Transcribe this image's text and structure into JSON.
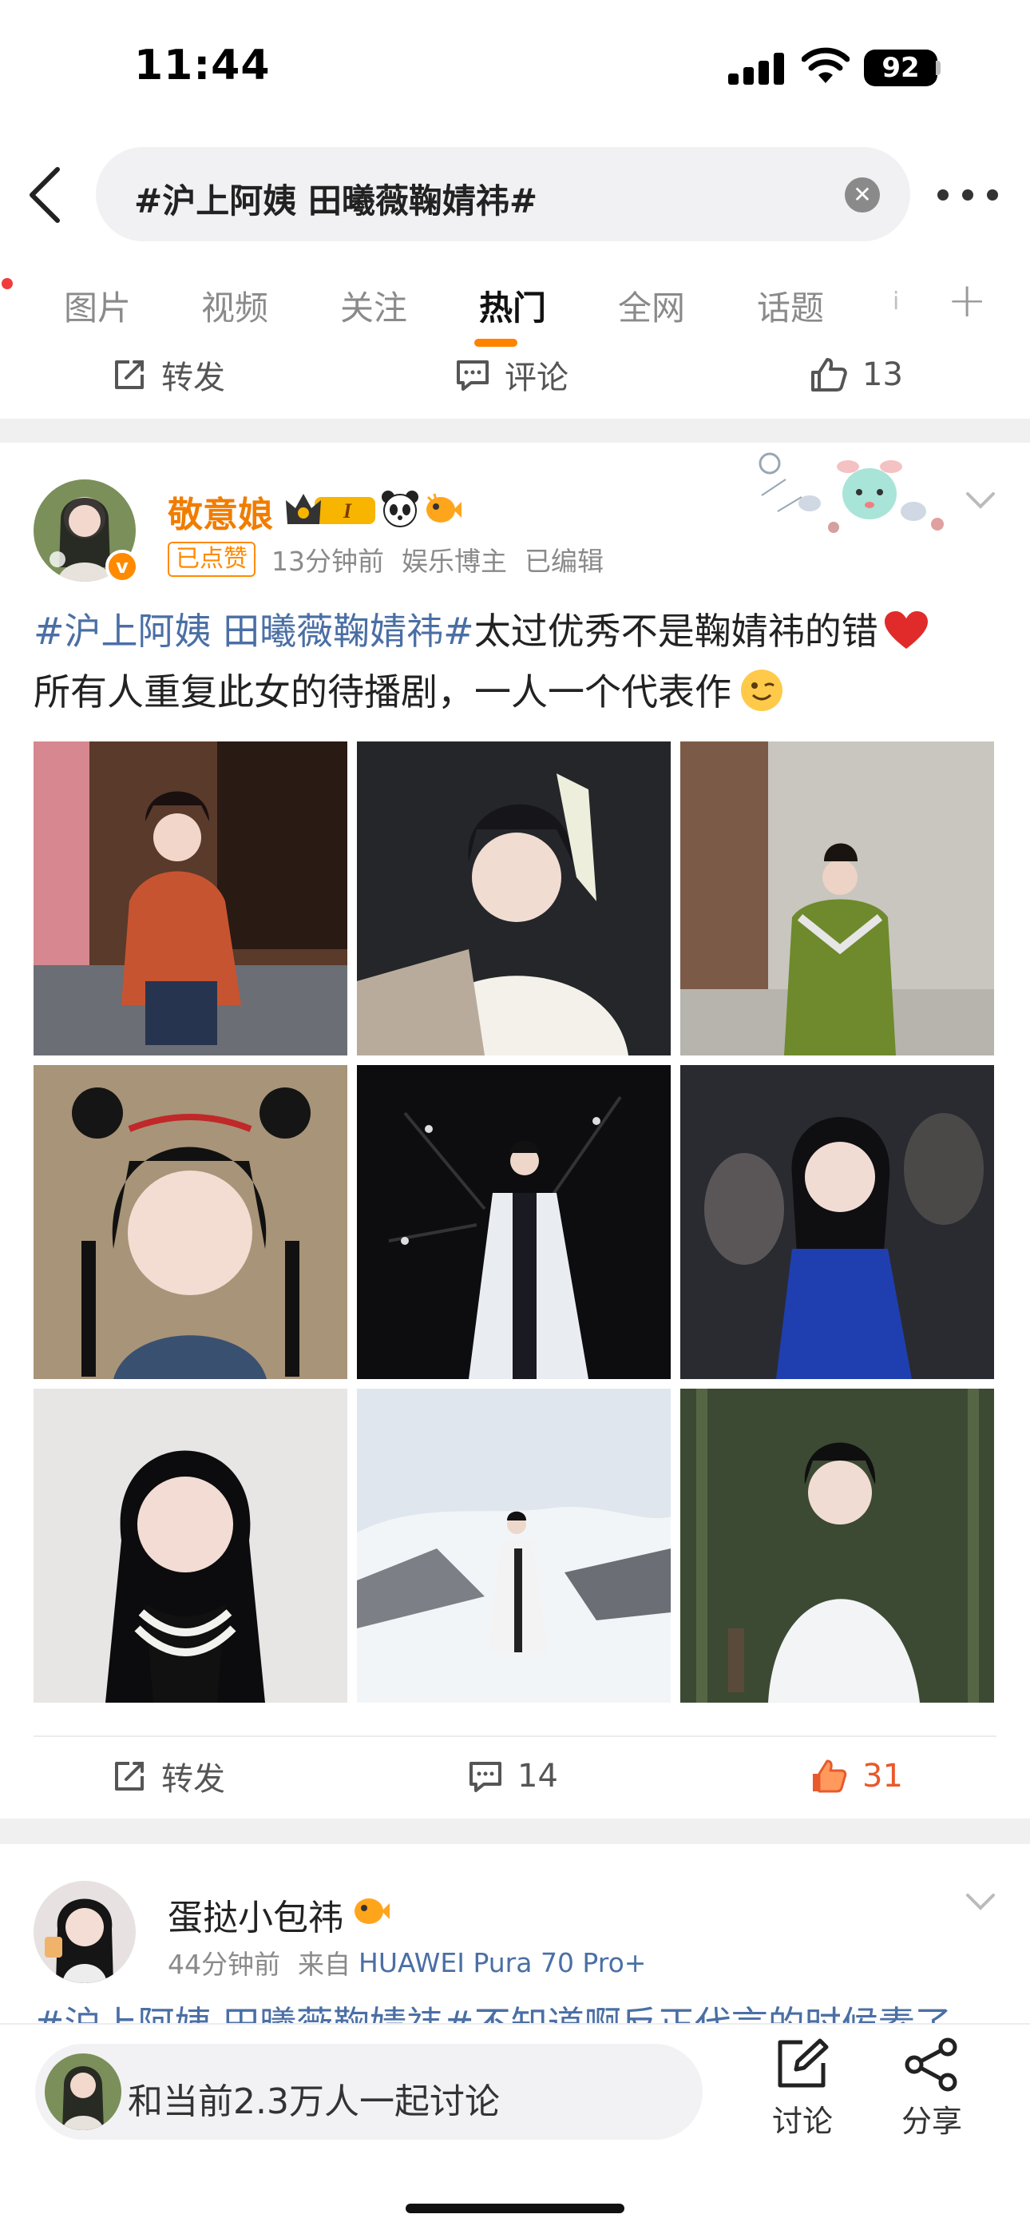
{
  "status_bar": {
    "time": "11:44",
    "battery": "92"
  },
  "search": {
    "query": "#沪上阿姨 田曦薇鞠婧祎#",
    "clear_icon": "close-icon",
    "more_icon": "more-dots-icon"
  },
  "tabs": [
    {
      "label": "图片"
    },
    {
      "label": "视频"
    },
    {
      "label": "关注"
    },
    {
      "label": "热门"
    },
    {
      "label": "全网"
    },
    {
      "label": "话题"
    },
    {
      "label": "i"
    }
  ],
  "active_tab": "热门",
  "accent_color": "#ff8200",
  "prev_post_actions": {
    "repost": "转发",
    "comment": "评论",
    "likes": "13"
  },
  "post1": {
    "author": "敬意娘",
    "liked_tag": "已点赞",
    "time": "13分钟前",
    "role": "娱乐博主",
    "edited": "已编辑",
    "text": {
      "hashtag": "#沪上阿姨 田曦薇鞠婧祎#",
      "line1_rest": "太过优秀不是鞠婧祎的错",
      "line2": "所有人重复此女的待播剧，一人一个代表作"
    },
    "photos": [
      "photo-1",
      "photo-2",
      "photo-3",
      "photo-4",
      "photo-5",
      "photo-6",
      "photo-7",
      "photo-8",
      "photo-9"
    ],
    "actions": {
      "repost": "转发",
      "comments": "14",
      "likes": "31"
    }
  },
  "post2": {
    "author": "蛋挞小包祎",
    "time": "44分钟前",
    "source_prefix": "来自",
    "source": "HUAWEI Pura 70 Pro+",
    "text_preview": "#沪上阿姨 田曦薇鞠婧祎#不知道啊反正代言的时候素了"
  },
  "bottom_bar": {
    "discuss_text": "和当前2.3万人一起讨论",
    "discuss_label": "讨论",
    "share_label": "分享"
  }
}
